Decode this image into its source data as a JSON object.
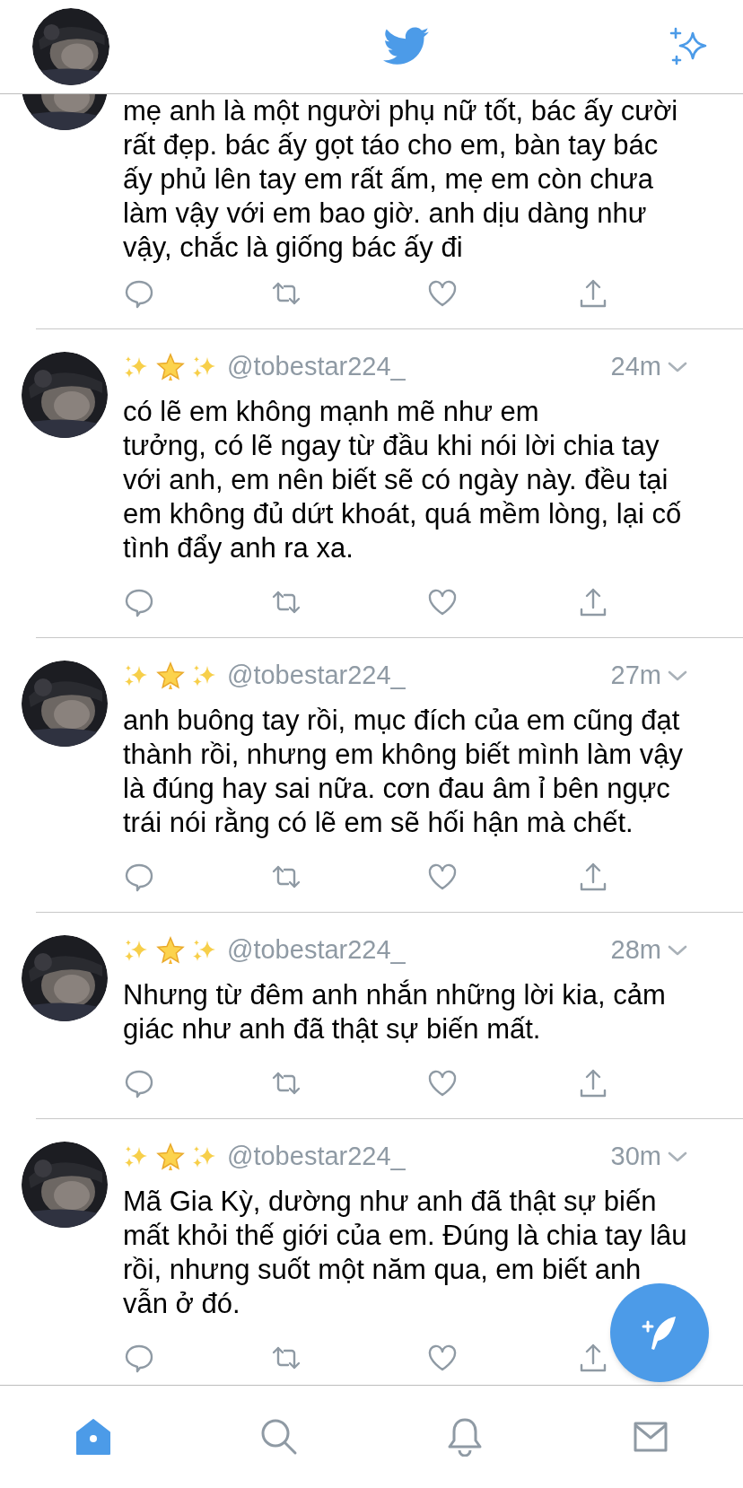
{
  "tweets": [
    {
      "text": "mẹ anh là một người phụ nữ tốt, bác ấy cười rất đẹp. bác ấy gọt táo cho em, bàn tay bác ấy phủ lên tay em rất ấm, mẹ em còn chưa làm vậy với em bao giờ. anh dịu dàng như vậy, chắc là giống bác ấy đi"
    },
    {
      "handle": "@tobestar224_",
      "time": "24m",
      "text": "có lẽ em không mạnh mẽ như em\ntưởng, có lẽ ngay từ đầu khi nói lời chia tay với anh, em nên biết sẽ có ngày này. đều tại em không đủ dứt khoát, quá mềm lòng, lại cố tình đẩy anh ra xa."
    },
    {
      "handle": "@tobestar224_",
      "time": "27m",
      "text": "anh buông tay rồi, mục đích của em cũng đạt thành rồi, nhưng em không biết mình làm vậy là đúng hay sai nữa. cơn đau âm ỉ bên ngực trái nói rằng có lẽ em sẽ hối hận mà chết."
    },
    {
      "handle": "@tobestar224_",
      "time": "28m",
      "text": "Nhưng từ đêm anh nhắn những lời kia, cảm giác như anh đã thật sự biến mất."
    },
    {
      "handle": "@tobestar224_",
      "time": "30m",
      "text": "Mã Gia Kỳ, dường như anh đã thật sự biến mất khỏi thế giới của em. Đúng là chia tay lâu rồi, nhưng suốt một năm qua, em biết anh vẫn ở đó."
    }
  ],
  "bottom_nav": [
    {
      "kind": "home",
      "selected": true
    },
    {
      "kind": "search",
      "selected": false
    },
    {
      "kind": "notifications",
      "selected": false
    },
    {
      "kind": "messages",
      "selected": false
    }
  ]
}
